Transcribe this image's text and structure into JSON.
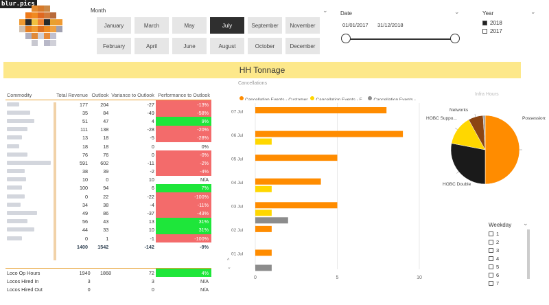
{
  "watermark": "blur.pics",
  "month": {
    "title": "Month",
    "row1": [
      "January",
      "March",
      "May",
      "July",
      "September",
      "November"
    ],
    "row2": [
      "February",
      "April",
      "June",
      "August",
      "October",
      "December"
    ],
    "selected": "July"
  },
  "date": {
    "title": "Date",
    "start": "01/01/2017",
    "end": "31/12/2018"
  },
  "year": {
    "title": "Year",
    "items": [
      {
        "label": "2018",
        "checked": true
      },
      {
        "label": "2017",
        "checked": false
      }
    ]
  },
  "banner": "HH Tonnage",
  "cancellations_label": "Cancellations",
  "table": {
    "headers": [
      "Commodity",
      "Total Revenue",
      "Outlook",
      "Variance to Outlook",
      "Performance to Outlook"
    ],
    "rows": [
      {
        "rev": "177",
        "out": "204",
        "var": "-27",
        "perf": "-13%",
        "status": "red"
      },
      {
        "rev": "35",
        "out": "84",
        "var": "-49",
        "perf": "-58%",
        "status": "red"
      },
      {
        "rev": "51",
        "out": "47",
        "var": "4",
        "perf": "9%",
        "status": "green"
      },
      {
        "rev": "111",
        "out": "138",
        "var": "-28",
        "perf": "-20%",
        "status": "red"
      },
      {
        "rev": "13",
        "out": "18",
        "var": "-5",
        "perf": "-28%",
        "status": "red"
      },
      {
        "rev": "18",
        "out": "18",
        "var": "0",
        "perf": "0%",
        "status": "none"
      },
      {
        "rev": "76",
        "out": "76",
        "var": "0",
        "perf": "-0%",
        "status": "red"
      },
      {
        "rev": "591",
        "out": "602",
        "var": "-11",
        "perf": "-2%",
        "status": "red"
      },
      {
        "rev": "38",
        "out": "39",
        "var": "-2",
        "perf": "-4%",
        "status": "red"
      },
      {
        "rev": "10",
        "out": "0",
        "var": "10",
        "perf": "N/A",
        "status": "none"
      },
      {
        "rev": "100",
        "out": "94",
        "var": "6",
        "perf": "7%",
        "status": "green"
      },
      {
        "rev": "0",
        "out": "22",
        "var": "-22",
        "perf": "-100%",
        "status": "red"
      },
      {
        "rev": "34",
        "out": "38",
        "var": "-4",
        "perf": "-11%",
        "status": "red"
      },
      {
        "rev": "49",
        "out": "86",
        "var": "-37",
        "perf": "-43%",
        "status": "red"
      },
      {
        "rev": "56",
        "out": "43",
        "var": "13",
        "perf": "31%",
        "status": "green"
      },
      {
        "rev": "44",
        "out": "33",
        "var": "10",
        "perf": "31%",
        "status": "green"
      },
      {
        "rev": "0",
        "out": "1",
        "var": "-1",
        "perf": "-100%",
        "status": "red"
      }
    ],
    "totals": {
      "rev": "1400",
      "out": "1542",
      "var": "-142",
      "perf": "-9%"
    }
  },
  "lower_table": {
    "rows": [
      {
        "label": "Loco Op Hours",
        "rev": "1940",
        "out": "1868",
        "var": "72",
        "perf": "4%",
        "status": "green"
      },
      {
        "label": "Locos Hired In",
        "rev": "3",
        "out": "",
        "var": "3",
        "perf": "N/A",
        "status": "none"
      },
      {
        "label": "Locos Hired Out",
        "rev": "0",
        "out": "",
        "var": "0",
        "perf": "N/A",
        "status": "none"
      }
    ]
  },
  "chart_data": [
    {
      "type": "bar",
      "orientation": "horizontal",
      "legend_position": "top-left",
      "categories": [
        "07 Jul",
        "06 Jul",
        "05 Jul",
        "04 Jul",
        "03 Jul",
        "02 Jul",
        "01 Jul"
      ],
      "series": [
        {
          "name": "Cancellation Events - Customer",
          "color": "#ff8c00",
          "values": [
            8,
            9,
            5,
            4,
            5,
            1,
            1
          ]
        },
        {
          "name": "Cancellation Events - F...",
          "color": "#ffd700",
          "values": [
            0,
            1,
            0,
            1,
            1,
            0,
            0
          ]
        },
        {
          "name": "Cancellation Events - ...",
          "color": "#8c8c8c",
          "values": [
            0,
            0,
            0,
            0,
            2,
            0,
            1
          ]
        }
      ],
      "xticks": [
        "0",
        "5",
        "10"
      ],
      "xlim": [
        0,
        10
      ],
      "grid": true
    },
    {
      "type": "pie",
      "title": "Infra Hours",
      "slices": [
        {
          "label": "Possessions",
          "value": 50,
          "color": "#ff8c00"
        },
        {
          "label": "HOBC Double",
          "value": 28,
          "color": "#1a1a1a"
        },
        {
          "label": "HOBC Suppo...",
          "value": 14,
          "color": "#ffd700"
        },
        {
          "label": "Networks",
          "value": 7,
          "color": "#8b4513"
        },
        {
          "label": "",
          "value": 1,
          "color": "#999999"
        }
      ]
    }
  ],
  "weekday": {
    "title": "Weekday",
    "items": [
      "1",
      "2",
      "3",
      "4",
      "5",
      "6",
      "7"
    ]
  },
  "colors": {
    "banner": "#fde88a",
    "selected_month": "#2f2f2f",
    "red": "#f36b6b",
    "green": "#1ee63a"
  }
}
